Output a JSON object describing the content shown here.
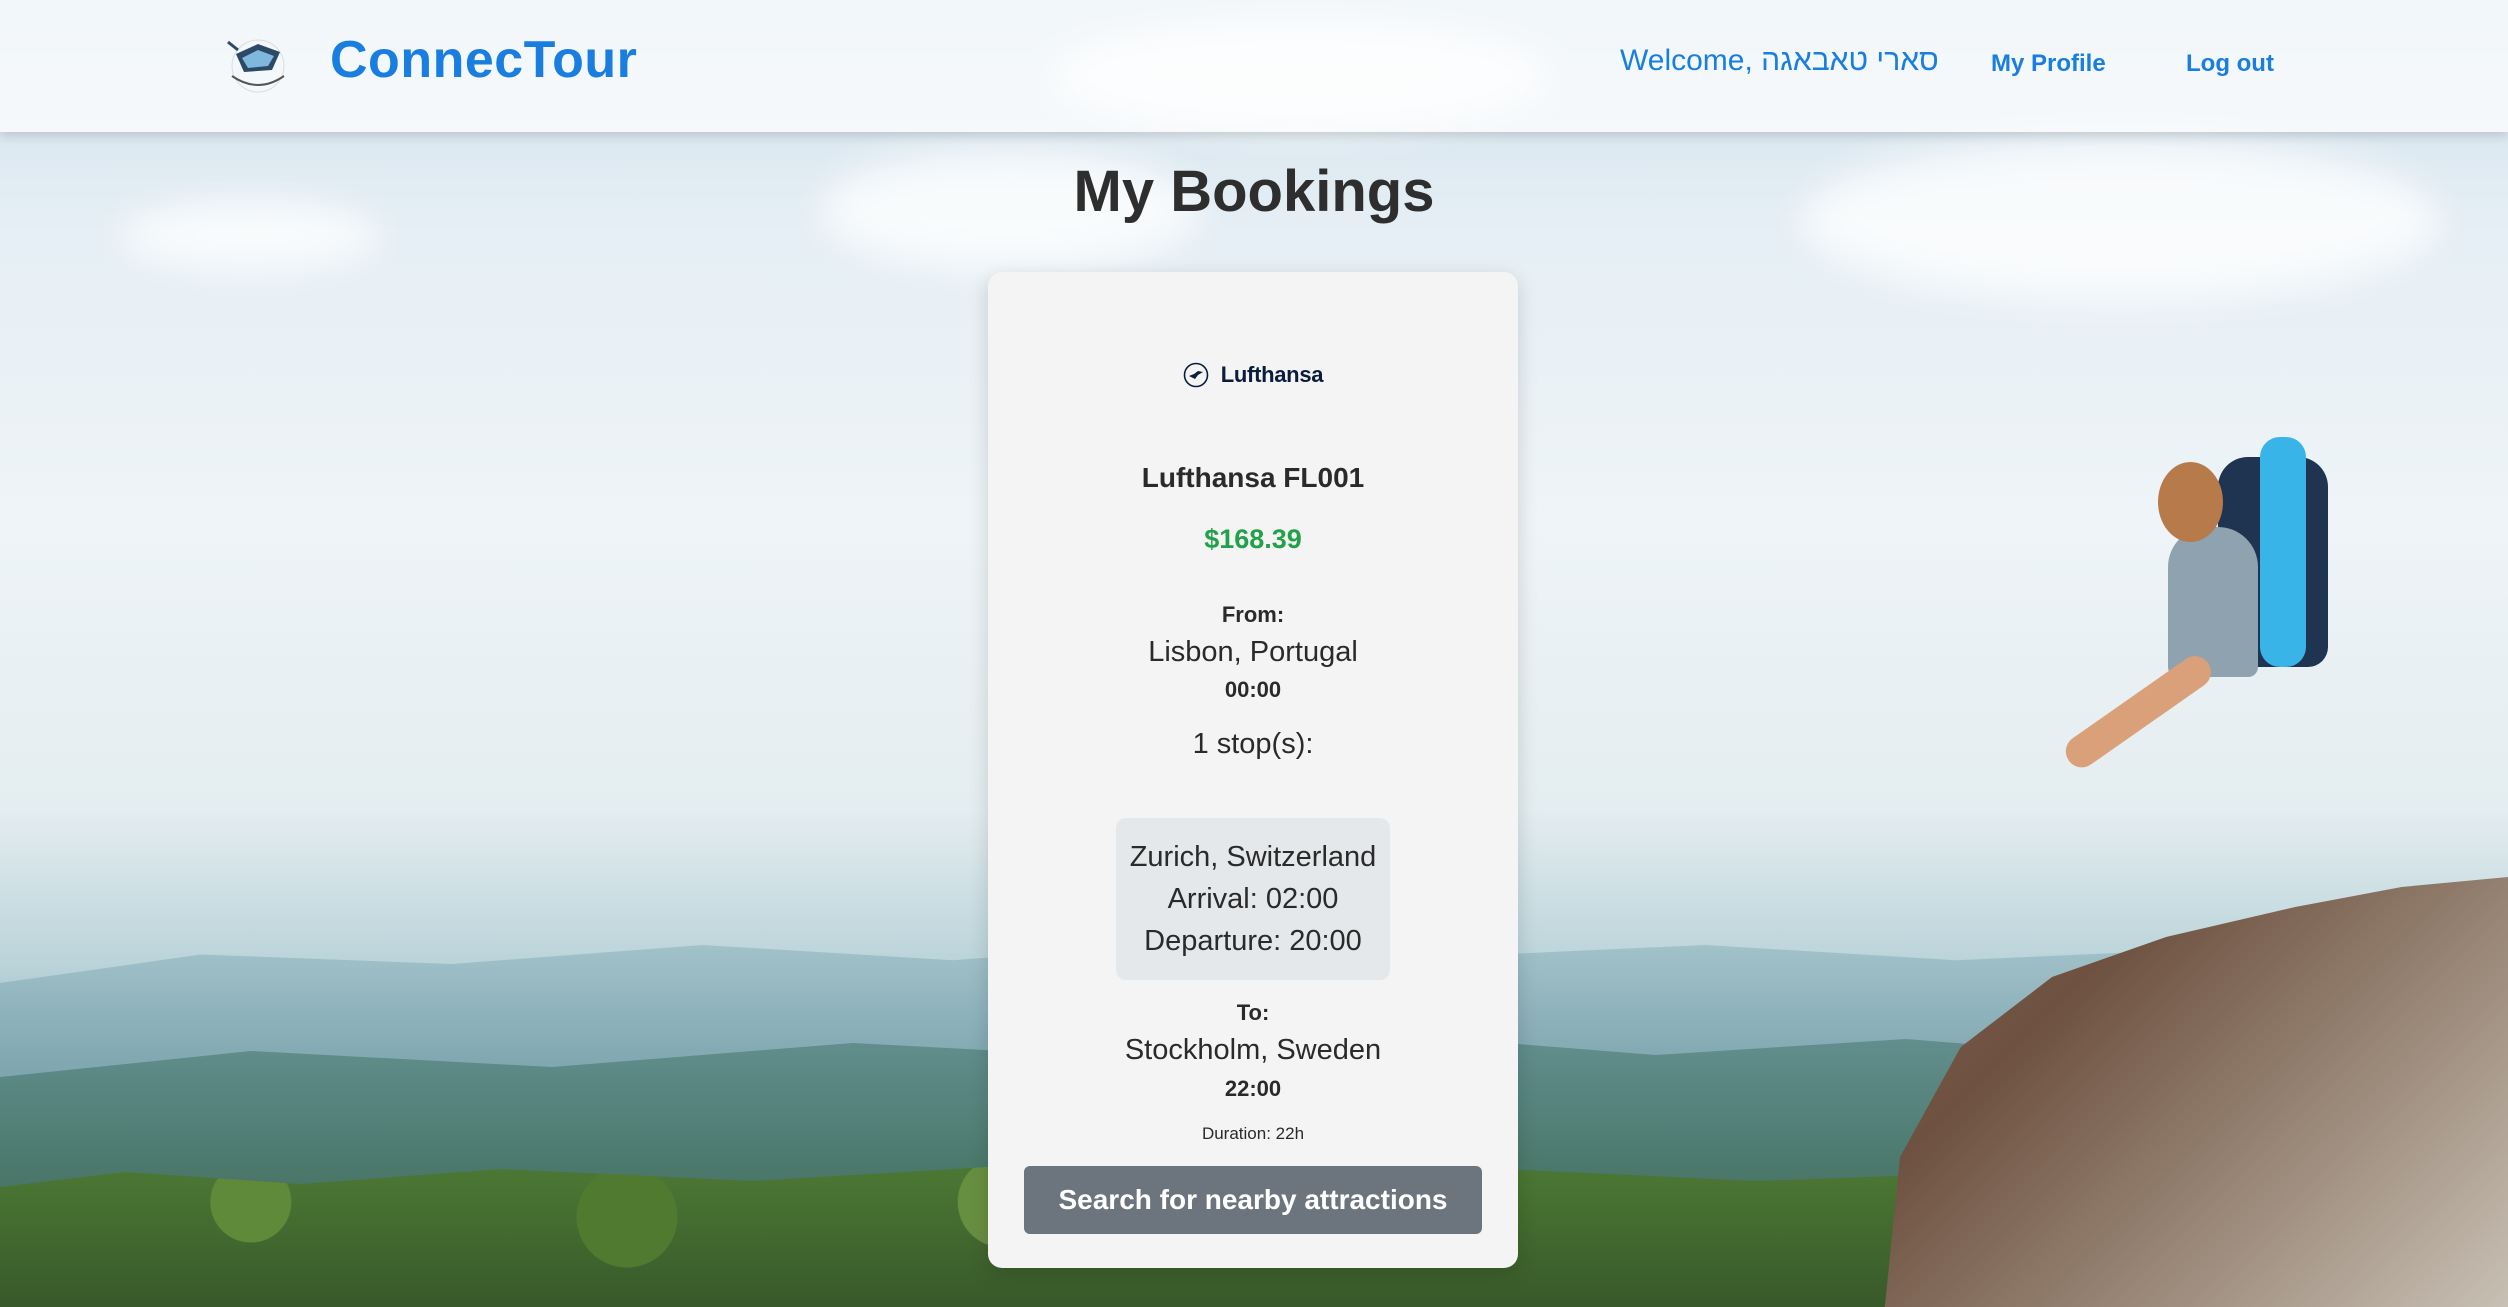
{
  "header": {
    "brand": "ConnecTour",
    "logo_icon": "connectour-logo-icon",
    "welcome": "Welcome, סארי טאבאגה",
    "nav": {
      "profile": "My Profile",
      "logout": "Log out"
    }
  },
  "page": {
    "title": "My Bookings"
  },
  "booking": {
    "airline_logo_text": "Lufthansa",
    "airline_logo_icon": "lufthansa-crane-icon",
    "flight_name": "Lufthansa FL001",
    "price": "$168.39",
    "from_label": "From:",
    "from_city": "Lisbon, Portugal",
    "from_time": "00:00",
    "stops_text": "1 stop(s):",
    "stop": {
      "city": "Zurich, Switzerland",
      "arrival": "Arrival: 02:00",
      "departure": "Departure: 20:00"
    },
    "to_label": "To:",
    "to_city": "Stockholm, Sweden",
    "to_time": "22:00",
    "duration": "Duration: 22h",
    "action_button": "Search for nearby attractions"
  },
  "colors": {
    "brand": "#1a7ee0",
    "price": "#22a14a",
    "button": "#6c757d"
  }
}
